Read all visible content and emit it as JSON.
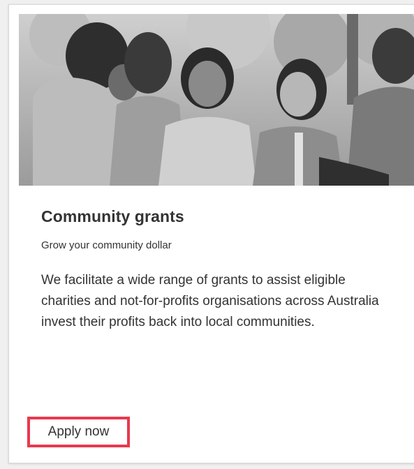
{
  "card": {
    "title": "Community grants",
    "subtitle": "Grow your community dollar",
    "description": "We facilitate a wide range of grants to assist eligible charities and not-for-profits organisations across Australia invest their profits back into local communities.",
    "cta_label": "Apply now"
  },
  "colors": {
    "highlight_border": "#e8394f",
    "text": "#333333",
    "card_background": "#ffffff"
  }
}
